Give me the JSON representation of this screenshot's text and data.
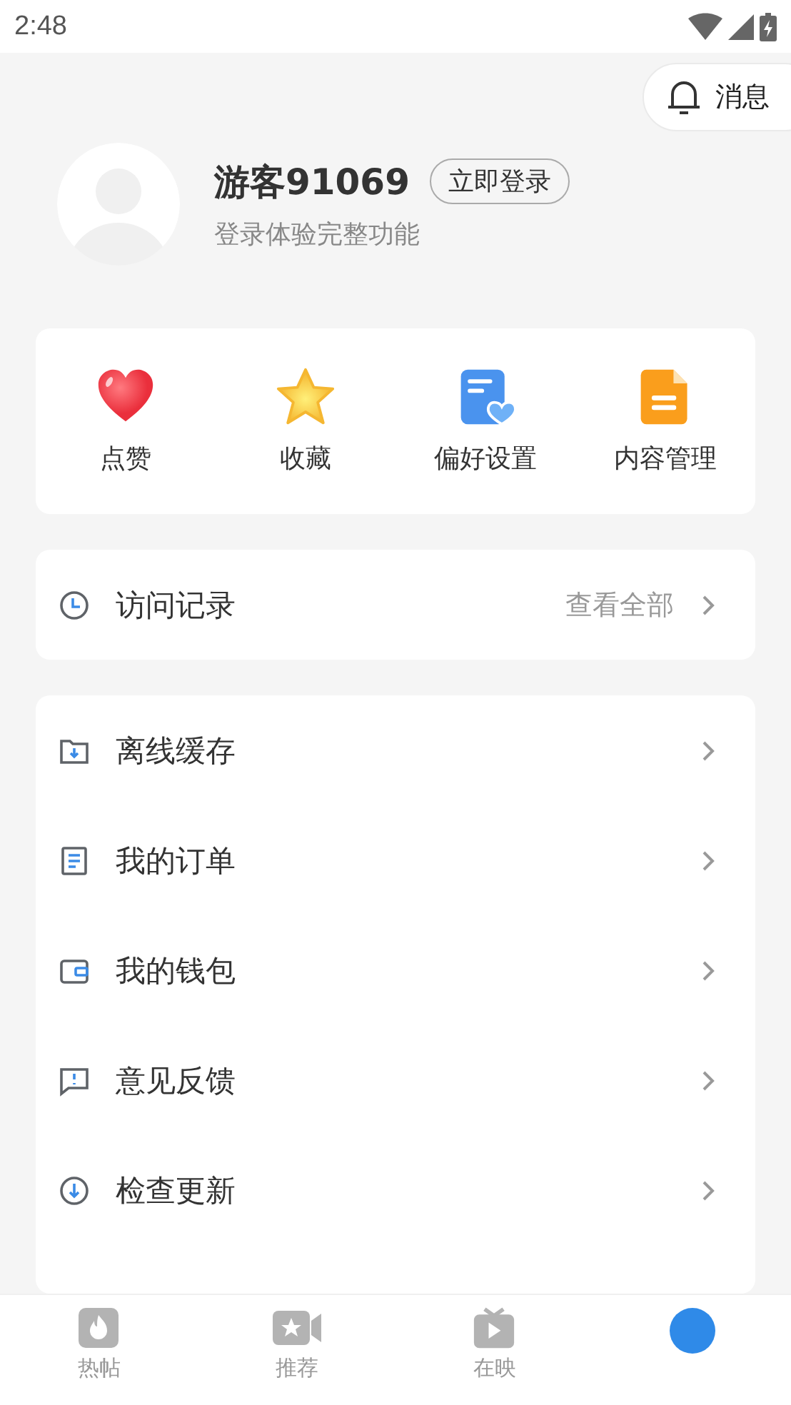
{
  "status_bar": {
    "time": "2:48"
  },
  "message_button": {
    "label": "消息"
  },
  "profile": {
    "name": "游客91069",
    "login_button": "立即登录",
    "subtitle": "登录体验完整功能"
  },
  "quick_actions": [
    {
      "kind": "heart",
      "label": "点赞"
    },
    {
      "kind": "star",
      "label": "收藏"
    },
    {
      "kind": "preference",
      "label": "偏好设置"
    },
    {
      "kind": "document",
      "label": "内容管理"
    }
  ],
  "history": {
    "title": "访问记录",
    "link": "查看全部"
  },
  "menu": [
    {
      "kind": "download-folder",
      "label": "离线缓存"
    },
    {
      "kind": "order",
      "label": "我的订单"
    },
    {
      "kind": "wallet",
      "label": "我的钱包"
    },
    {
      "kind": "feedback",
      "label": "意见反馈"
    },
    {
      "kind": "update",
      "label": "检查更新"
    }
  ],
  "tabs": [
    {
      "kind": "fire",
      "label": "热帖",
      "selected": false
    },
    {
      "kind": "video",
      "label": "推荐",
      "selected": false
    },
    {
      "kind": "tv",
      "label": "在映",
      "selected": false
    },
    {
      "kind": "me",
      "selected": true
    }
  ]
}
